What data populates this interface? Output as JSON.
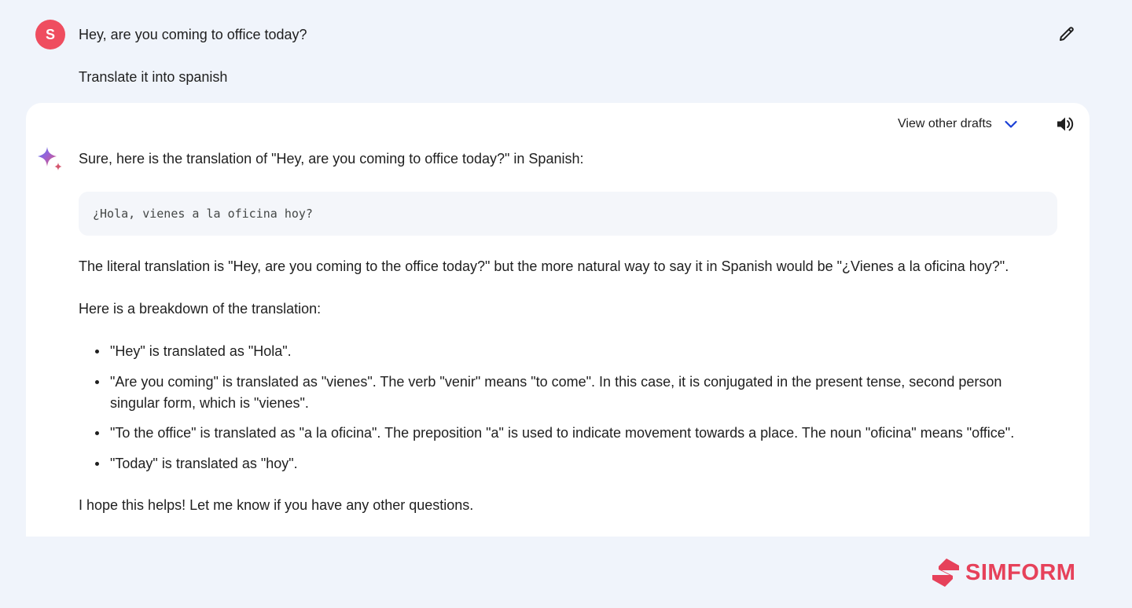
{
  "user": {
    "avatar_letter": "S",
    "message_line1": "Hey, are you coming to office today?",
    "message_line2": "Translate it into spanish"
  },
  "response": {
    "drafts_label": "View other drafts",
    "intro": "Sure, here is the translation of \"Hey, are you coming to office today?\" in Spanish:",
    "code": "¿Hola, vienes a la oficina hoy?",
    "literal_note": "The literal translation is \"Hey, are you coming to the office today?\" but the more natural way to say it in Spanish would be \"¿Vienes a la oficina hoy?\".",
    "breakdown_heading": "Here is a breakdown of the translation:",
    "bullets": [
      "\"Hey\" is translated as \"Hola\".",
      "\"Are you coming\" is translated as \"vienes\". The verb \"venir\" means \"to come\". In this case, it is conjugated in the present tense, second person singular form, which is \"vienes\".",
      "\"To the office\" is translated as \"a la oficina\". The preposition \"a\" is used to indicate movement towards a place. The noun \"oficina\" means \"office\".",
      "\"Today\" is translated as \"hoy\"."
    ],
    "closing": "I hope this helps! Let me know if you have any other questions."
  },
  "brand": {
    "logo_text": "SIMFORM",
    "logo_color": "#e6415a"
  },
  "colors": {
    "background": "#f0f4fb",
    "avatar": "#ef4d5f",
    "accent_chevron": "#1a3fd6"
  },
  "icons": {
    "edit": "pencil-icon",
    "drafts": "chevron-down-icon",
    "speaker": "speaker-icon",
    "assistant": "sparkle-icon"
  }
}
